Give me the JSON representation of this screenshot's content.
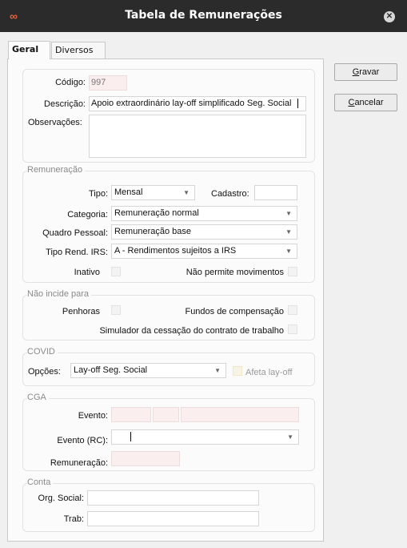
{
  "window": {
    "title": "Tabela de Remunerações",
    "logo": "∞"
  },
  "tabs": [
    {
      "label": "Geral",
      "active": true
    },
    {
      "label": "Diversos",
      "active": false
    }
  ],
  "buttons": {
    "save": {
      "underline": "G",
      "rest": "ravar"
    },
    "cancel": {
      "underline": "C",
      "rest": "ancelar"
    }
  },
  "main": {
    "codigo_label": "Código:",
    "codigo_value": "997",
    "descricao_label": "Descrição:",
    "descricao_value": "Apoio extraordinário lay-off simplificado Seg. Social",
    "observacoes_label": "Observações:",
    "observacoes_value": ""
  },
  "remuneracao": {
    "title": "Remuneração",
    "tipo_label": "Tipo:",
    "tipo_value": "Mensal",
    "cadastro_label": "Cadastro:",
    "cadastro_value": "",
    "categoria_label": "Categoria:",
    "categoria_value": "Remuneração normal",
    "quadro_label": "Quadro Pessoal:",
    "quadro_value": "Remuneração base",
    "irs_label": "Tipo Rend. IRS:",
    "irs_value": "A - Rendimentos sujeitos a IRS",
    "inativo_label": "Inativo",
    "inativo_checked": false,
    "naopermite_label": "Não permite movimentos",
    "naopermite_checked": false
  },
  "naoincide": {
    "title": "Não incide para",
    "penhoras_label": "Penhoras",
    "fundos_label": "Fundos de compensação",
    "simulador_label": "Simulador da cessação do contrato de trabalho"
  },
  "covid": {
    "title": "COVID",
    "opcoes_label": "Opções:",
    "opcoes_value": "Lay-off Seg. Social",
    "afeta_label": "Afeta lay-off"
  },
  "cga": {
    "title": "CGA",
    "evento_label": "Evento:",
    "evento_rc_label": "Evento (RC):",
    "remuneracao_label": "Remuneração:"
  },
  "conta": {
    "title": "Conta",
    "org_label": "Org. Social:",
    "org_value": "",
    "trab_label": "Trab:",
    "trab_value": ""
  },
  "icons": {
    "dropdown": "chevron-down-icon",
    "close": "close-icon",
    "logo": "infinity-logo-icon"
  },
  "colors": {
    "titlebar": "#2b2b2b",
    "logo": "#e8633b",
    "required_field": "#fbeeee"
  }
}
